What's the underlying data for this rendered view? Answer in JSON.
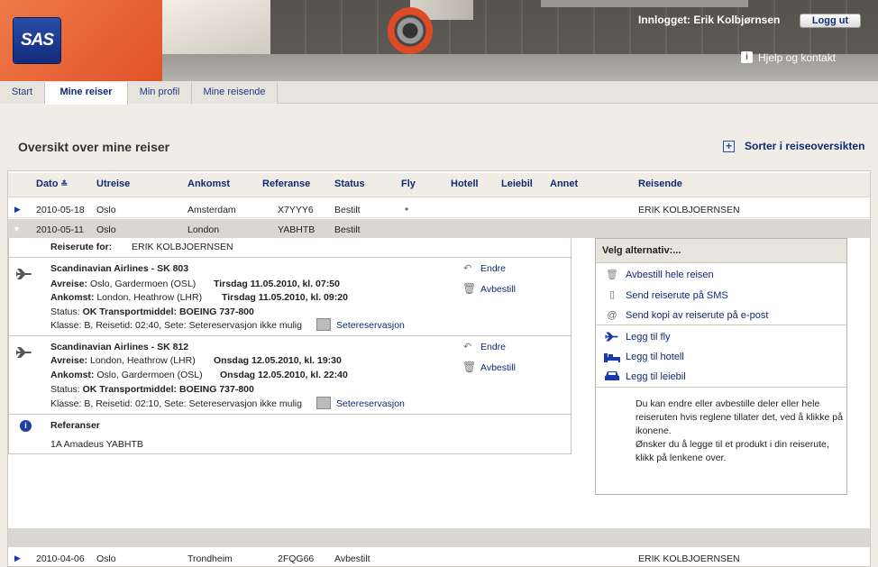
{
  "header": {
    "logo_text": "SAS",
    "logged_in_text": "Innlogget: Erik Kolbjørnsen",
    "logout_label": "Logg ut",
    "help_label": "Hjelp og kontakt"
  },
  "tabs": [
    {
      "label": "Start",
      "active": false
    },
    {
      "label": "Mine reiser",
      "active": true
    },
    {
      "label": "Min profil",
      "active": false
    },
    {
      "label": "Mine reisende",
      "active": false
    }
  ],
  "page": {
    "title": "Oversikt over mine reiser",
    "sort_label": "Sorter i reiseoversikten"
  },
  "table": {
    "columns": [
      "Dato",
      "Utreise",
      "Ankomst",
      "Referanse",
      "Status",
      "Fly",
      "Hotell",
      "Leiebil",
      "Annet",
      "Reisende"
    ],
    "rows": [
      {
        "date": "2010-05-18",
        "from": "Oslo",
        "to": "Amsterdam",
        "ref": "X7YYY6",
        "status": "Bestilt",
        "fly": "•",
        "traveler": "ERIK KOLBJOERNSEN",
        "expanded": false
      },
      {
        "date": "2010-05-11",
        "from": "Oslo",
        "to": "London",
        "ref": "YABHTB",
        "status": "Bestilt",
        "fly": "",
        "traveler": "",
        "expanded": true
      },
      {
        "date": "2010-04-06",
        "from": "Oslo",
        "to": "Trondheim",
        "ref": "2FQG66",
        "status": "Avbestilt",
        "fly": "",
        "traveler": "ERIK KOLBJOERNSEN",
        "expanded": false
      }
    ]
  },
  "detail": {
    "itinerary_label": "Reiserute for:",
    "itinerary_name": "ERIK KOLBJOERNSEN",
    "flights": [
      {
        "title": "Scandinavian Airlines - SK 803",
        "dep_label": "Avreise:",
        "dep_place": "Oslo, Gardermoen (OSL)",
        "dep_time": "Tirsdag 11.05.2010, kl. 07:50",
        "arr_label": "Ankomst:",
        "arr_place": "London, Heathrow (LHR)",
        "arr_time": "Tirsdag 11.05.2010, kl. 09:20",
        "status_label": "Status:",
        "status_value": "OK",
        "transport_label": "Transportmiddel:",
        "transport_value": "BOEING 737-800",
        "class_line": "Klasse: B, Reisetid: 02:40, Sete: Setereservasjon ikke mulig",
        "seat_link": "Setereservasjon",
        "change_label": "Endre",
        "cancel_label": "Avbestill"
      },
      {
        "title": "Scandinavian Airlines - SK 812",
        "dep_label": "Avreise:",
        "dep_place": "London, Heathrow (LHR)",
        "dep_time": "Onsdag 12.05.2010, kl. 19:30",
        "arr_label": "Ankomst:",
        "arr_place": "Oslo, Gardermoen (OSL)",
        "arr_time": "Onsdag 12.05.2010, kl. 22:40",
        "status_label": "Status:",
        "status_value": "OK",
        "transport_label": "Transportmiddel:",
        "transport_value": "BOEING 737-800",
        "class_line": "Klasse: B, Reisetid: 02:10, Sete: Setereservasjon ikke mulig",
        "seat_link": "Setereservasjon",
        "change_label": "Endre",
        "cancel_label": "Avbestill"
      }
    ],
    "references_title": "Referanser",
    "references_value": "1A Amadeus YABHTB"
  },
  "options": {
    "title": "Velg alternativ:...",
    "items": [
      "Avbestill hele reisen",
      "Send reiserute på SMS",
      "Send kopi av reiserute på e-post",
      "Legg til fly",
      "Legg til hotell",
      "Legg til leiebil"
    ],
    "info_line1": "Du kan endre eller avbestille deler eller hele reiseruten hvis reglene tillater det, ved å klikke på ikonene.",
    "info_line2": "Ønsker du å legge til et produkt i din reiserute, klikk på lenkene over."
  },
  "colors": {
    "brand_orange": "#e2522a",
    "brand_blue": "#142c7a",
    "link_blue": "#0e2a72"
  }
}
